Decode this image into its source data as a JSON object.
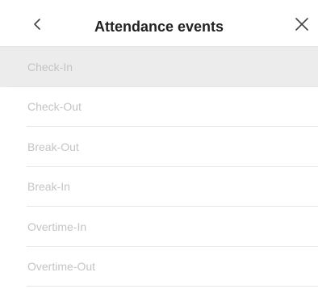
{
  "header": {
    "title": "Attendance events",
    "back_icon": "chevron-left-icon",
    "close_icon": "close-icon"
  },
  "events": [
    {
      "label": "Check-In",
      "selected": true
    },
    {
      "label": "Check-Out",
      "selected": false
    },
    {
      "label": "Break-Out",
      "selected": false
    },
    {
      "label": "Break-In",
      "selected": false
    },
    {
      "label": "Overtime-In",
      "selected": false
    },
    {
      "label": "Overtime-Out",
      "selected": false
    }
  ],
  "colors": {
    "selected_background": "#ececec",
    "item_text": "#c4c4c4",
    "title_text": "#222222",
    "divider": "#e6e6e6"
  }
}
